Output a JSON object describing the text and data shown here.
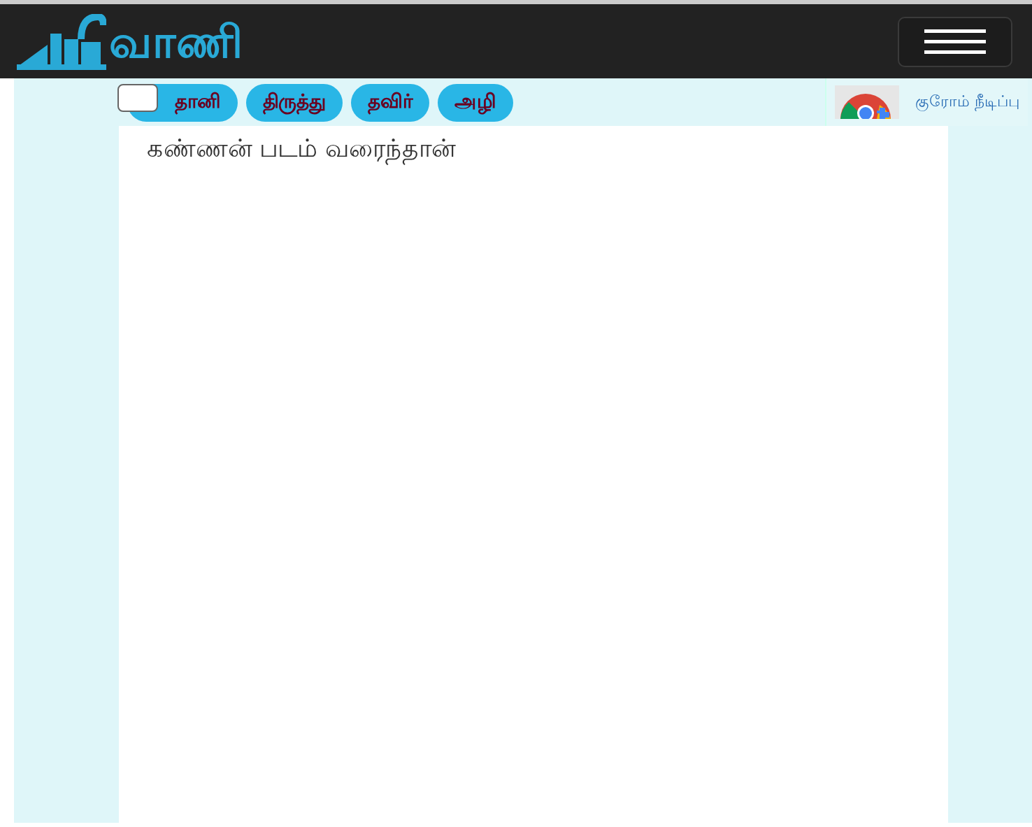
{
  "header": {
    "logo": "வாணி"
  },
  "toolbar": {
    "checkbox": {
      "checked": false
    },
    "buttons": [
      "தானி",
      "திருத்து",
      "தவிர்",
      "அழி"
    ]
  },
  "extension_link": "குரோம் நீடிப்பு",
  "editor": {
    "value": "கண்ணன் படம் வரைந்தான்"
  }
}
